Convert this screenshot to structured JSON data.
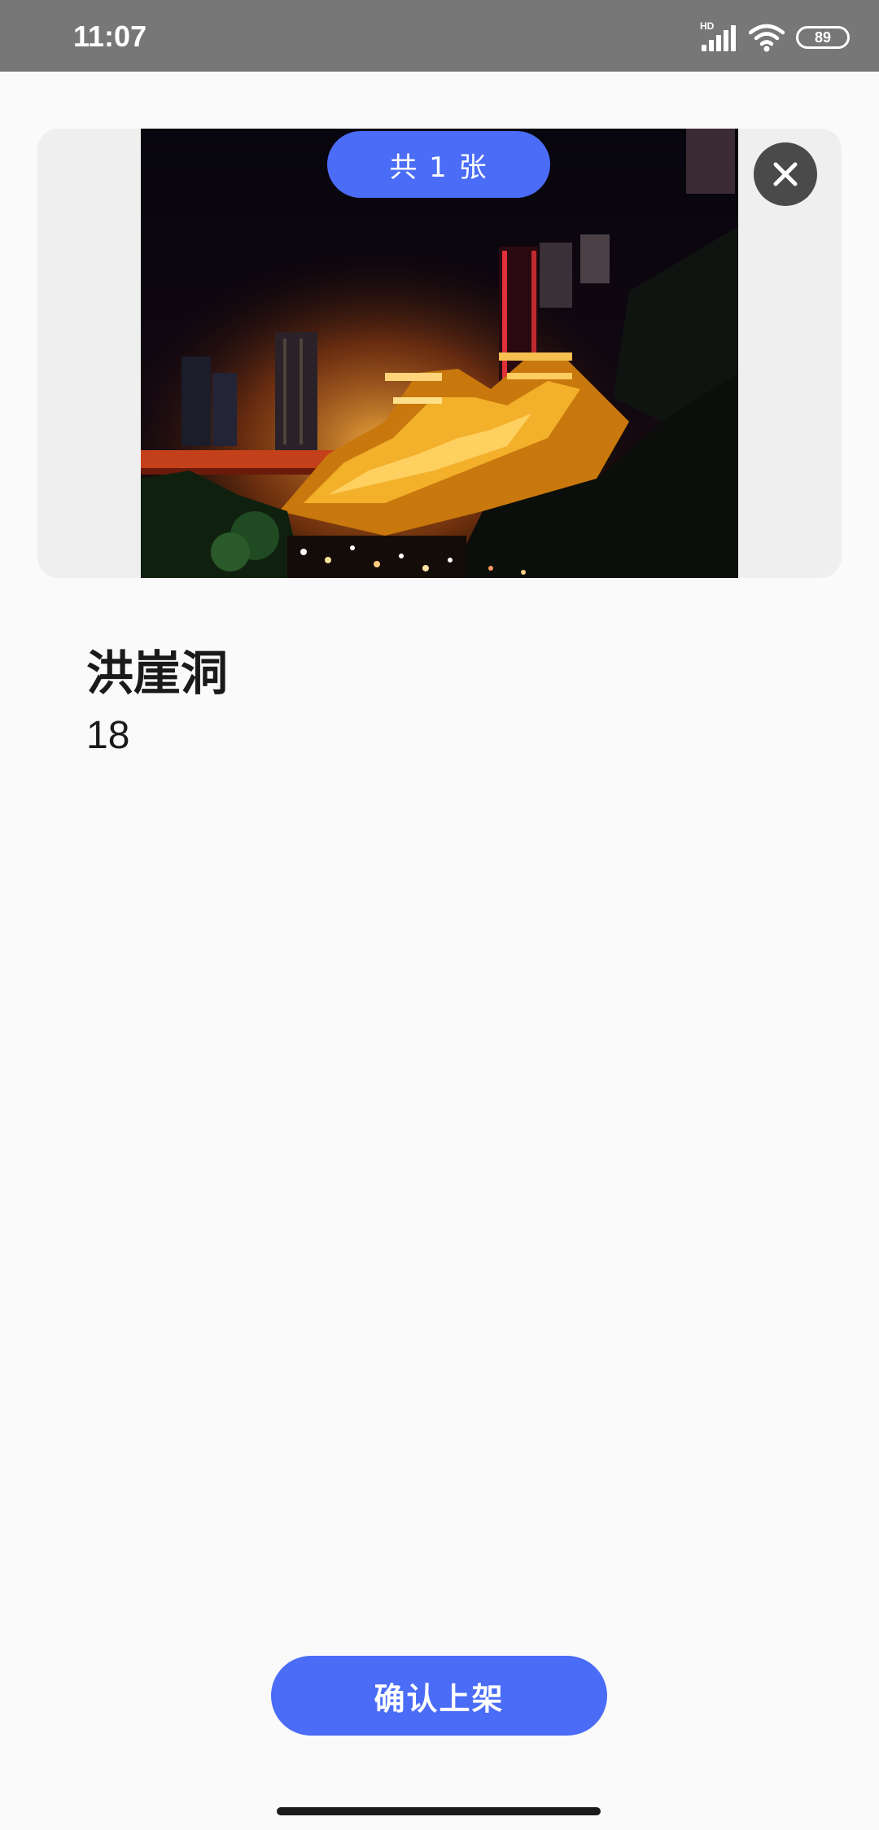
{
  "status_bar": {
    "time": "11:07",
    "network_label": "HD",
    "battery": "89",
    "icons": [
      "signal-icon",
      "wifi-icon",
      "battery-icon"
    ]
  },
  "gallery": {
    "count_label": "共 1 张",
    "photo_icon": "night-city-photo",
    "close_icon": "close-icon"
  },
  "item": {
    "title": "洪崖洞",
    "price": "18"
  },
  "actions": {
    "confirm_label": "确认上架"
  },
  "colors": {
    "accent": "#4a6cf7",
    "status_bar": "#777777",
    "background": "#fafafa"
  }
}
